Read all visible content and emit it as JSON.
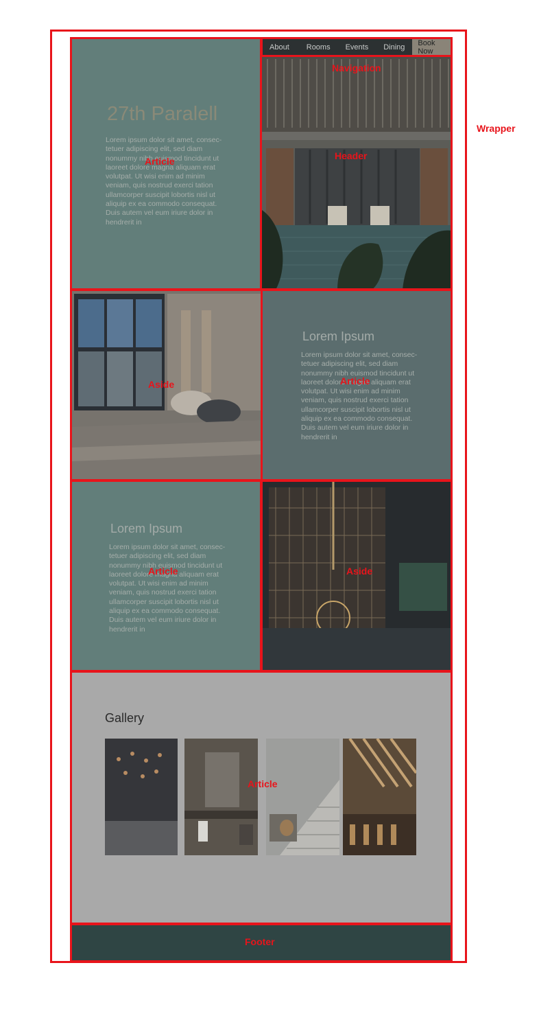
{
  "labels": {
    "wrapper": "Wrapper",
    "navigation": "Navigation",
    "header": "Header",
    "article": "Article",
    "aside": "Aside",
    "footer": "Footer"
  },
  "nav": {
    "items": [
      "About",
      "Rooms",
      "Events",
      "Dining"
    ],
    "cta": "Book Now"
  },
  "hero": {
    "title": "27th Paralell",
    "body": "Lorem ipsum dolor sit amet, consec-\ntetuer adipiscing elit, sed diam\nnonummy nibh euismod tincidunt ut\nlaoreet dolore magna aliquam erat\nvolutpat. Ut wisi enim ad minim\nveniam, quis nostrud exerci tation\nullamcorper suscipit lobortis nisl ut\naliquip ex ea commodo consequat.\nDuis autem vel eum iriure dolor in\nhendrerit in"
  },
  "article2": {
    "title": "Lorem Ipsum",
    "body": "Lorem ipsum dolor sit amet, consec-\ntetuer adipiscing elit, sed diam\nnonummy nibh euismod tincidunt ut\nlaoreet dolore magna aliquam erat\nvolutpat. Ut wisi enim ad minim\nveniam, quis nostrud exerci tation\nullamcorper suscipit lobortis nisl ut\naliquip ex ea commodo consequat.\nDuis autem vel eum iriure dolor in\nhendrerit in"
  },
  "article3": {
    "title": "Lorem Ipsum",
    "body": "Lorem ipsum dolor sit amet, consec-\ntetuer adipiscing elit, sed diam\nnonummy nibh euismod tincidunt ut\nlaoreet dolore magna aliquam erat\nvolutpat. Ut wisi enim ad minim\nveniam, quis nostrud exerci tation\nullamcorper suscipit lobortis nisl ut\naliquip ex ea commodo consequat.\nDuis autem vel eum iriure dolor in\nhendrerit in"
  },
  "gallery": {
    "title": "Gallery"
  },
  "colors": {
    "outline": "#e8141b",
    "panel_teal": "#627e7a",
    "panel_grey": "#a9a9a9",
    "footer": "#2f4544"
  }
}
